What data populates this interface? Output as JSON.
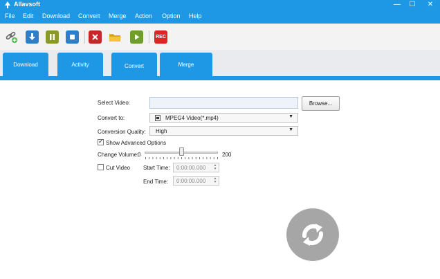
{
  "app": {
    "title": "Allavsoft"
  },
  "window_controls": {
    "minimize": "—",
    "maximize": "☐",
    "close": "✕"
  },
  "menu": [
    "File",
    "Edit",
    "Download",
    "Convert",
    "Merge",
    "Action",
    "Option",
    "Help"
  ],
  "toolbar": {
    "rec_label": "REC"
  },
  "tabs": [
    "Download",
    "Activity",
    "Convert",
    "Merge"
  ],
  "active_tab": "Convert",
  "form": {
    "select_video_label": "Select Video:",
    "select_video_value": "",
    "browse_label": "Browse...",
    "convert_to_label": "Convert to:",
    "convert_to_value": "MPEG4 Video(*.mp4)",
    "quality_label": "Conversion Quality:",
    "quality_value": "High",
    "advanced_label": "Show Advanced Options",
    "advanced_checked": true,
    "volume_label": "Change Volume:",
    "volume_min": "0",
    "volume_max": "200",
    "volume_value": 100,
    "cut_video_label": "Cut Video",
    "cut_video_checked": false,
    "start_time_label": "Start Time:",
    "start_time_value": "0:00:00.000",
    "end_time_label": "End Time:",
    "end_time_value": "0:00:00.000"
  },
  "colors": {
    "accent": "#1e98e5",
    "rec": "#e02424",
    "convert_button": "#a6a6a6"
  }
}
